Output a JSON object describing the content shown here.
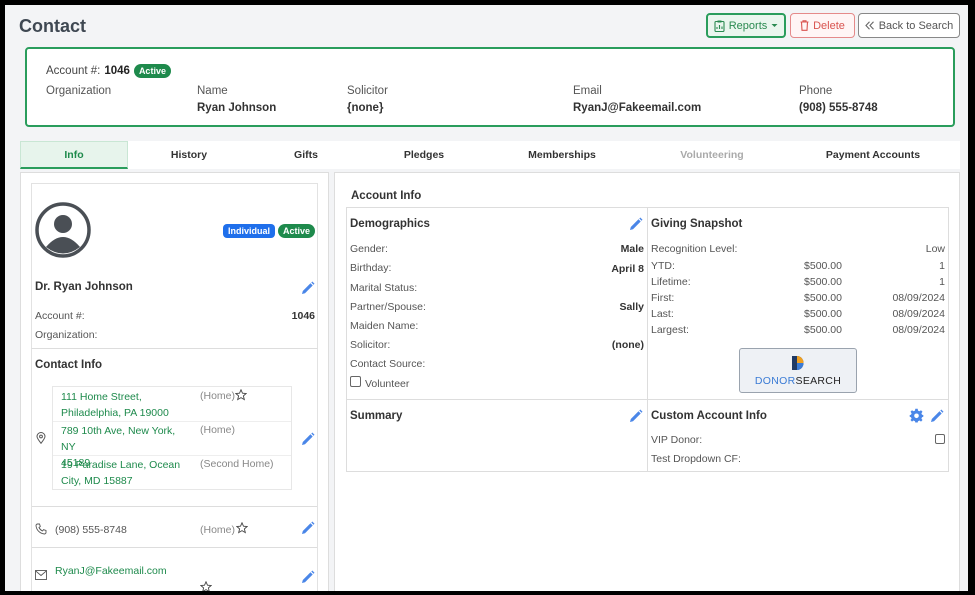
{
  "page": {
    "title": "Contact"
  },
  "toolbar": {
    "reports": "Reports",
    "delete": "Delete",
    "back": "Back to Search"
  },
  "account": {
    "label": "Account #:",
    "number": "1046",
    "status": "Active",
    "organization_label": "Organization",
    "name_label": "Name",
    "name": "Ryan Johnson",
    "solicitor_label": "Solicitor",
    "solicitor": "{none}",
    "email_label": "Email",
    "email": "RyanJ@Fakeemail.com",
    "phone_label": "Phone",
    "phone": "(908) 555-8748"
  },
  "tabs": [
    {
      "label": "Info",
      "state": "active"
    },
    {
      "label": "History"
    },
    {
      "label": "Gifts"
    },
    {
      "label": "Pledges"
    },
    {
      "label": "Memberships"
    },
    {
      "label": "Volunteering",
      "state": "disabled"
    },
    {
      "label": "Payment Accounts"
    }
  ],
  "profile": {
    "type_badge": "Individual",
    "status_badge": "Active",
    "full_name": "Dr. Ryan Johnson",
    "account_label": "Account #:",
    "account_value": "1046",
    "organization_label": "Organization:"
  },
  "contact_info": {
    "title": "Contact Info",
    "addresses": [
      {
        "line1": "111 Home Street,",
        "line2": "Philadelphia, PA 19000",
        "type": "(Home)"
      },
      {
        "line1": "789 10th Ave, New York, NY",
        "line2": "45189",
        "type": "(Home)"
      },
      {
        "line1": "19 Paradise Lane, Ocean",
        "line2": "City, MD 15887",
        "type": "(Second Home)"
      }
    ],
    "phone": "(908) 555-8748",
    "phone_type": "(Home)",
    "email": "RyanJ@Fakeemail.com"
  },
  "account_info": {
    "title": "Account Info",
    "demographics": {
      "title": "Demographics",
      "rows": [
        {
          "label": "Gender:",
          "value": "Male"
        },
        {
          "label": "Birthday:",
          "value": "April 8"
        },
        {
          "label": "Marital Status:",
          "value": ""
        },
        {
          "label": "Partner/Spouse:",
          "value": "Sally"
        },
        {
          "label": "Maiden Name:",
          "value": ""
        },
        {
          "label": "Solicitor:",
          "value": "(none)"
        },
        {
          "label": "Contact Source:",
          "value": ""
        }
      ],
      "volunteer_label": "Volunteer"
    },
    "giving": {
      "title": "Giving Snapshot",
      "recognition_label": "Recognition Level:",
      "recognition_value": "Low",
      "rows": [
        {
          "label": "YTD:",
          "amount": "$500.00",
          "extra": "1"
        },
        {
          "label": "Lifetime:",
          "amount": "$500.00",
          "extra": "1"
        },
        {
          "label": "First:",
          "amount": "$500.00",
          "extra": "08/09/2024"
        },
        {
          "label": "Last:",
          "amount": "$500.00",
          "extra": "08/09/2024"
        },
        {
          "label": "Largest:",
          "amount": "$500.00",
          "extra": "08/09/2024"
        }
      ],
      "logo_part1": "DONOR",
      "logo_part2": "SEARCH"
    },
    "summary": {
      "title": "Summary"
    },
    "custom": {
      "title": "Custom Account Info",
      "vip_label": "VIP Donor:",
      "dropdown_label": "Test Dropdown CF:"
    }
  },
  "colors": {
    "accent": "#2a9d5c",
    "link": "#1e8a4c",
    "edit": "#4a86e8",
    "badge_blue": "#1f6feb"
  }
}
